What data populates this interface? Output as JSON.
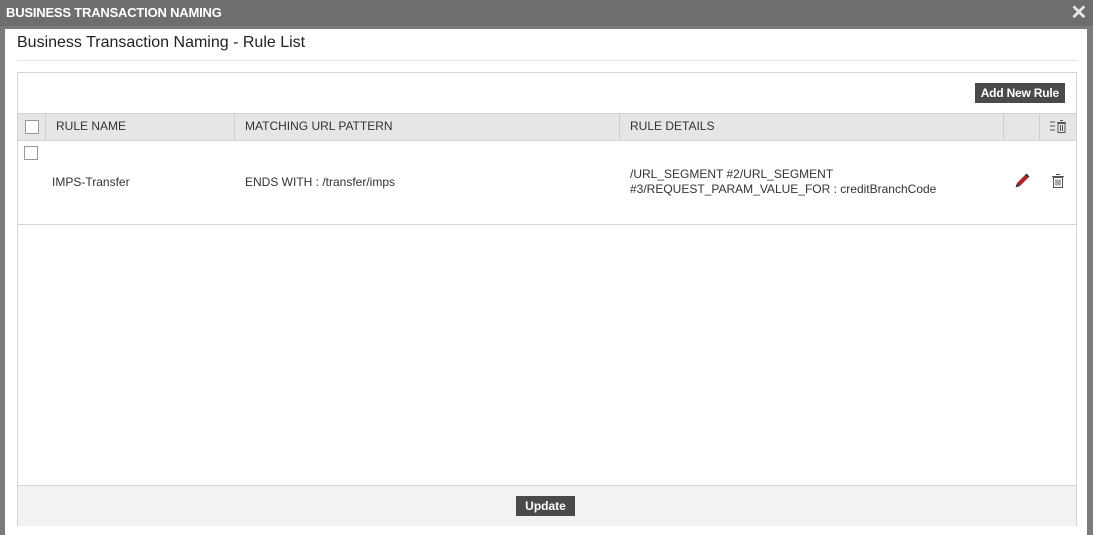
{
  "dialog": {
    "title": "BUSINESS TRANSACTION NAMING",
    "close_glyph": "✕",
    "subtitle": "Business Transaction Naming - Rule List"
  },
  "toolbar": {
    "add_label": "Add New Rule"
  },
  "table": {
    "headers": {
      "rule_name": "RULE NAME",
      "matching_url_pattern": "MATCHING URL PATTERN",
      "rule_details": "RULE DETAILS"
    },
    "rows": [
      {
        "rule_name": "IMPS-Transfer",
        "matching_url_pattern": "ENDS WITH : /transfer/imps",
        "rule_details_line1": "/URL_SEGMENT #2/URL_SEGMENT",
        "rule_details_line2": "#3/REQUEST_PARAM_VALUE_FOR : creditBranchCode",
        "edit_icon": "pencil-icon",
        "delete_icon": "trash-icon"
      }
    ],
    "header_action_icon": "bulk-delete-icon"
  },
  "footer": {
    "update_label": "Update"
  },
  "colors": {
    "titlebar": "#6e6e6e",
    "button": "#4a4a4a",
    "header_bg": "#e6e6e6",
    "pencil": "#b22222"
  }
}
